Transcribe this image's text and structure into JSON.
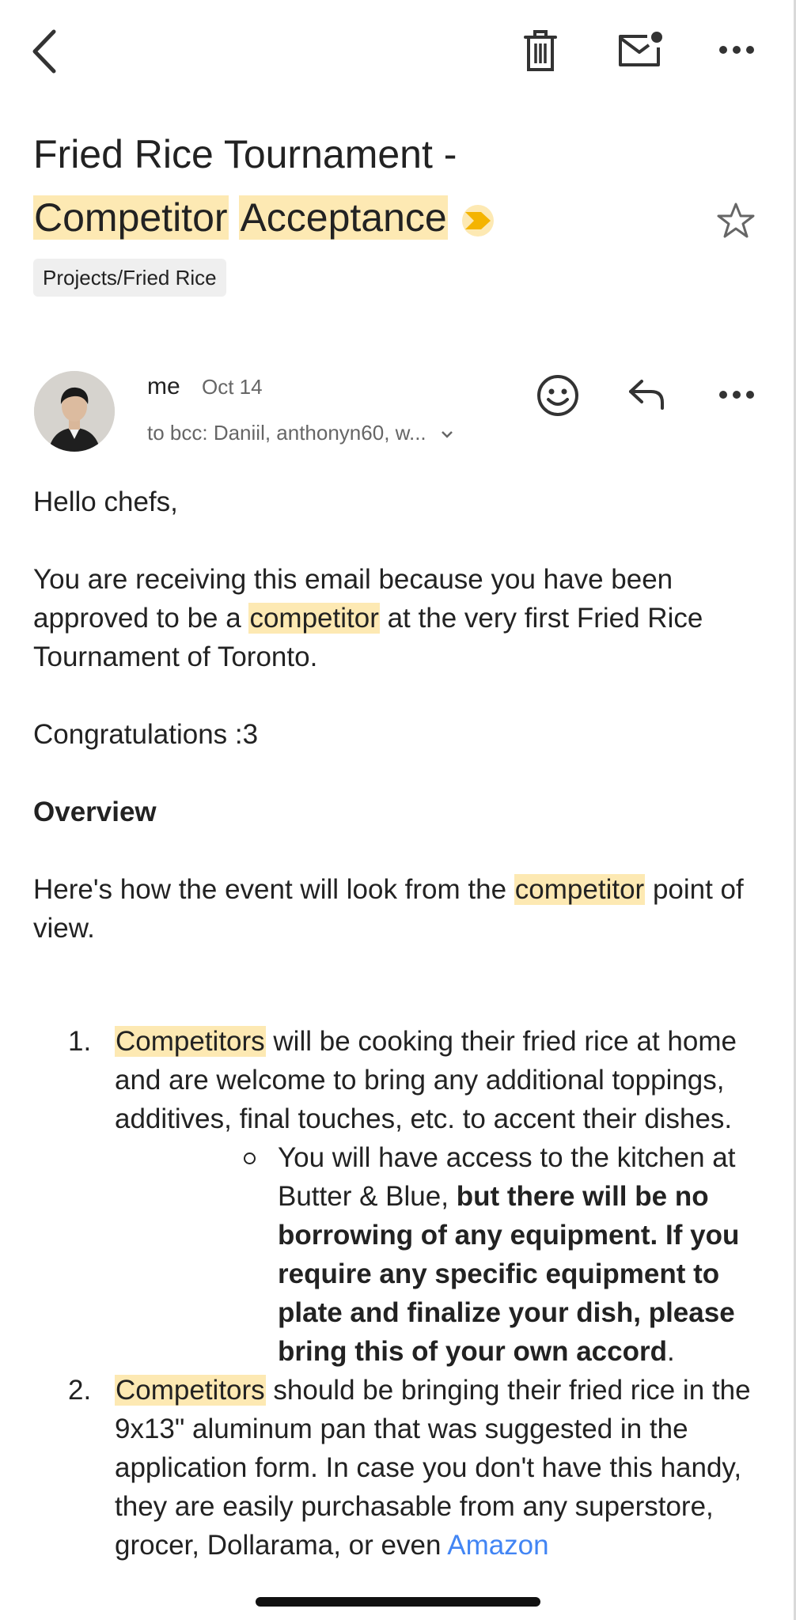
{
  "topbar": {
    "back_icon": "chevron-left-icon",
    "delete_icon": "trash-icon",
    "mark_unread_icon": "mail-unread-icon",
    "more_icon": "more-horizontal-icon"
  },
  "email": {
    "subject_line1": "Fried Rice Tournament -",
    "subject_hl1": "Competitor",
    "subject_hl2": "Acceptance",
    "label": "Projects/Fried Rice",
    "sender": "me",
    "date": "Oct 14",
    "recipients": "to bcc: Daniil, anthonyn60, w...",
    "highlight_color": "#fde9b3",
    "important_color": "#f4b400"
  },
  "body": {
    "greeting": "Hello chefs,",
    "p1_a": "You are receiving this email because you have been approved to be a",
    "p1_hl": "competitor",
    "p1_b": "at the very first Fried Rice Tournament of Toronto.",
    "congrats": "Congratulations :3",
    "overview_heading": "Overview",
    "p2_a": "Here's how the event will look from the",
    "p2_hl": "competitor",
    "p2_b": "point of view.",
    "items": [
      {
        "num": "1.",
        "hl": "Competitors",
        "text": "will be cooking their fried rice at home and are welcome to bring any additional toppings, additives, final touches, etc. to accent their dishes.",
        "sub": {
          "plain": "You will have access to the kitchen at Butter & Blue,",
          "bold": "but there will be no borrowing of any equipment. If you require any specific equipment to plate and finalize your dish, please bring this of your own accord",
          "end": "."
        }
      },
      {
        "num": "2.",
        "hl": "Competitors",
        "text": "should be bringing their fried rice in the 9x13\" aluminum pan that was suggested in the application form. In case you don't have this handy, they are easily purchasable from any superstore, grocer, Dollarama, or even",
        "link": "Amazon"
      }
    ]
  }
}
